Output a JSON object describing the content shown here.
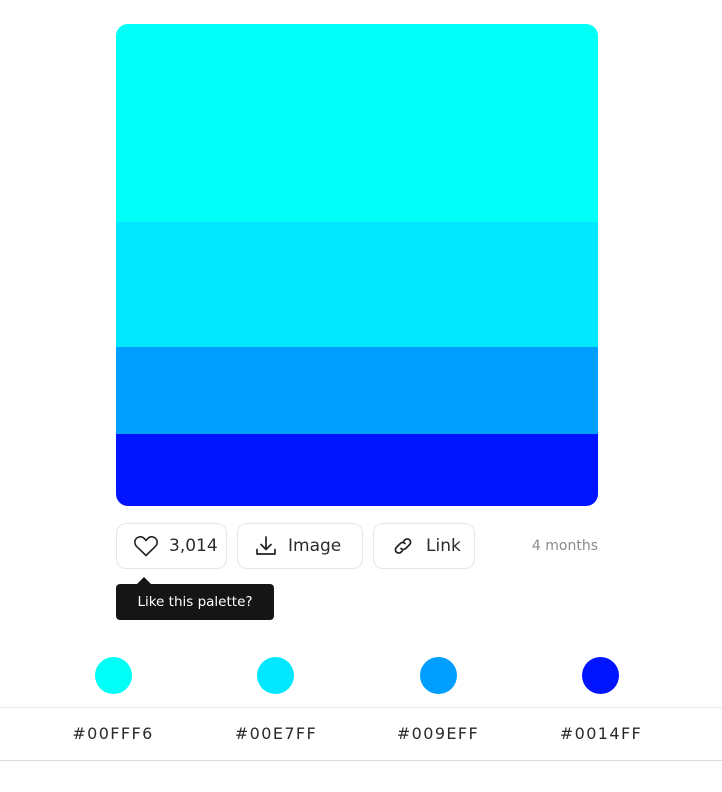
{
  "palette": {
    "colors": [
      "#00FFF6",
      "#00E7FF",
      "#009EFF",
      "#0014FF"
    ]
  },
  "actions": {
    "like_count": "3,014",
    "image_label": "Image",
    "link_label": "Link",
    "time_ago": "4 months"
  },
  "tooltip": {
    "text": "Like this palette?"
  },
  "hex_codes": [
    "#00FFF6",
    "#00E7FF",
    "#009EFF",
    "#0014FF"
  ],
  "icons": {
    "like": "heart-icon",
    "image": "download-icon",
    "link": "link-icon"
  }
}
